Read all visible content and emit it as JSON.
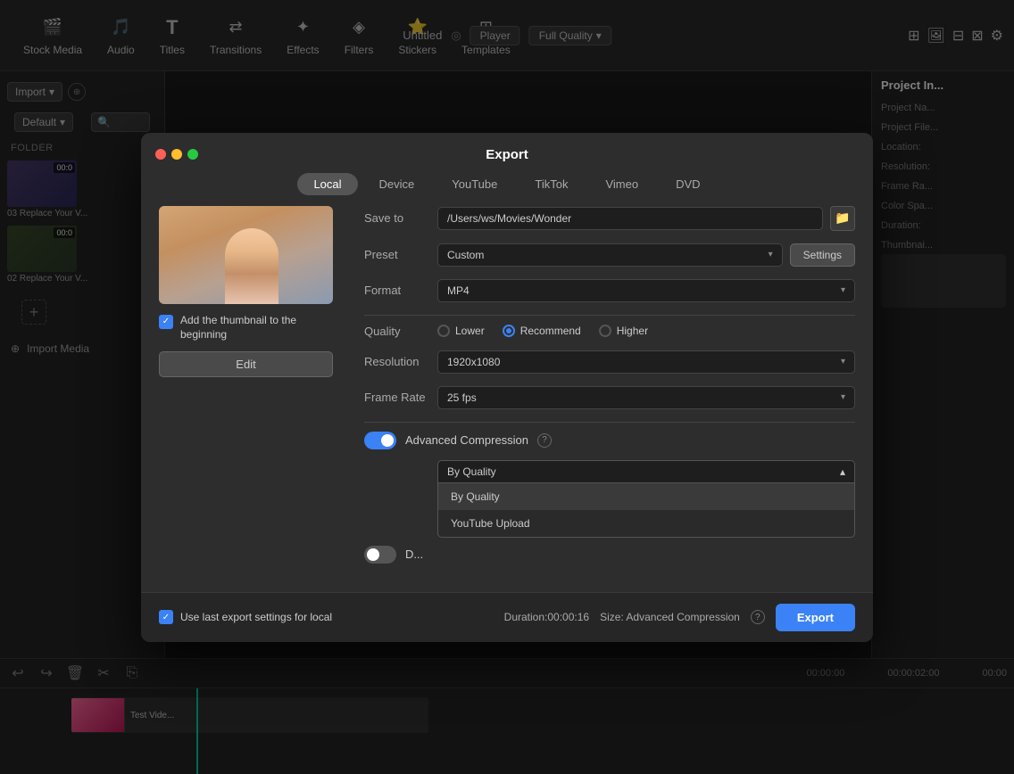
{
  "app": {
    "title": "Untitled"
  },
  "toolbar": {
    "items": [
      {
        "id": "stock-media",
        "label": "Stock Media",
        "icon": "🎬"
      },
      {
        "id": "audio",
        "label": "Audio",
        "icon": "🎵"
      },
      {
        "id": "titles",
        "label": "Titles",
        "icon": "T"
      },
      {
        "id": "transitions",
        "label": "Transitions",
        "icon": "↔"
      },
      {
        "id": "effects",
        "label": "Effects",
        "icon": "✦"
      },
      {
        "id": "filters",
        "label": "Filters",
        "icon": "◈"
      },
      {
        "id": "stickers",
        "label": "Stickers",
        "icon": "⭐"
      },
      {
        "id": "templates",
        "label": "Templates",
        "icon": "⊞"
      }
    ],
    "player_label": "Player",
    "quality_label": "Full Quality"
  },
  "modal": {
    "title": "Export",
    "tabs": [
      {
        "id": "local",
        "label": "Local",
        "active": true
      },
      {
        "id": "device",
        "label": "Device"
      },
      {
        "id": "youtube",
        "label": "YouTube"
      },
      {
        "id": "tiktok",
        "label": "TikTok"
      },
      {
        "id": "vimeo",
        "label": "Vimeo"
      },
      {
        "id": "dvd",
        "label": "DVD"
      }
    ],
    "save_to_label": "Save to",
    "save_to_value": "/Users/ws/Movies/Wonder",
    "preset_label": "Preset",
    "preset_value": "Custom",
    "format_label": "Format",
    "format_value": "MP4",
    "settings_btn": "Settings",
    "quality_label": "Quality",
    "quality_options": [
      {
        "id": "lower",
        "label": "Lower",
        "selected": false
      },
      {
        "id": "recommend",
        "label": "Recommend",
        "selected": true
      },
      {
        "id": "higher",
        "label": "Higher",
        "selected": false
      }
    ],
    "resolution_label": "Resolution",
    "resolution_value": "1920x1080",
    "framerate_label": "Frame Rate",
    "framerate_value": "25 fps",
    "thumbnail_label": "Add the thumbnail to the beginning",
    "edit_btn": "Edit",
    "adv_compression_label": "Advanced Compression",
    "by_quality_label": "By Quality",
    "dropdown_options": [
      {
        "id": "by-quality",
        "label": "By Quality",
        "highlighted": true
      },
      {
        "id": "youtube-upload",
        "label": "YouTube Upload"
      }
    ],
    "footer": {
      "use_last_label": "Use last export settings for local",
      "duration_label": "Duration:00:00:16",
      "size_label": "Size: Advanced Compression",
      "export_btn": "Export"
    }
  },
  "sidebar": {
    "import_btn": "Import",
    "default_btn": "Default",
    "folder_label": "FOLDER",
    "import_media_label": "Import Media",
    "media_items": [
      {
        "label": "03 Replace Your V...",
        "duration": "00:0"
      },
      {
        "label": "02 Replace Your V...",
        "duration": "00:0"
      }
    ]
  },
  "right_panel": {
    "title": "Project In...",
    "fields": [
      {
        "label": "Project Na...",
        "value": ""
      },
      {
        "label": "Project File...",
        "value": ""
      },
      {
        "label": "Location:",
        "value": ""
      },
      {
        "label": "Resolution:",
        "value": ""
      },
      {
        "label": "Frame Ra...",
        "value": ""
      },
      {
        "label": "Color Spa...",
        "value": ""
      },
      {
        "label": "Duration:",
        "value": ""
      },
      {
        "label": "Thumbnai...",
        "value": ""
      }
    ]
  },
  "timeline": {
    "time_labels": [
      "00:00:00",
      "00:00:02:00",
      "00:00"
    ],
    "undo_icon": "↩",
    "redo_icon": "↪",
    "delete_icon": "🗑",
    "cut_icon": "✂",
    "copy_icon": "⎘"
  }
}
